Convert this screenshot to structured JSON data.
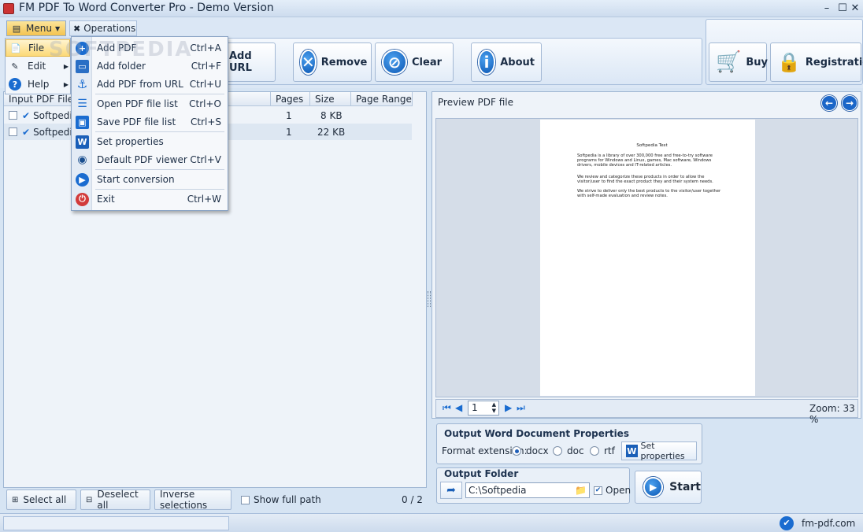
{
  "window": {
    "title": "FM PDF To Word Converter Pro - Demo Version",
    "min": "–",
    "max": "☐",
    "close": "✕"
  },
  "menubar": {
    "menu_label": "Menu",
    "operations_label": "Operations"
  },
  "left_menu": [
    {
      "label": "File",
      "selected": true
    },
    {
      "label": "Edit",
      "selected": false
    },
    {
      "label": "Help",
      "selected": false
    }
  ],
  "dropdown": [
    {
      "label": "Add PDF",
      "shortcut": "Ctrl+A",
      "icon": "plus-icon"
    },
    {
      "label": "Add folder",
      "shortcut": "Ctrl+F",
      "icon": "folder-icon"
    },
    {
      "label": "Add PDF from URL",
      "shortcut": "Ctrl+U",
      "icon": "anchor-icon"
    },
    {
      "label": "Open PDF file list",
      "shortcut": "Ctrl+O",
      "icon": "list-icon"
    },
    {
      "label": "Save PDF file list",
      "shortcut": "Ctrl+S",
      "icon": "floppy-icon"
    },
    {
      "label": "Set properties",
      "shortcut": "",
      "icon": "word-icon"
    },
    {
      "label": "Default PDF viewer",
      "shortcut": "Ctrl+V",
      "icon": "eye-icon"
    },
    {
      "label": "Start conversion",
      "shortcut": "",
      "icon": "play-icon"
    },
    {
      "label": "Exit",
      "shortcut": "Ctrl+W",
      "icon": "power-icon"
    }
  ],
  "toolbar": {
    "add_url": "Add URL",
    "remove": "Remove",
    "clear": "Clear",
    "about": "About",
    "buy": "Buy",
    "registration": "Registration"
  },
  "file_list": {
    "columns": [
      "Input PDF File",
      "Pages",
      "Size",
      "Page Range"
    ],
    "rows": [
      {
        "name": "Softpedia",
        "pages": "1",
        "size": "8 KB",
        "range": ""
      },
      {
        "name": "Softpedia",
        "pages": "1",
        "size": "22 KB",
        "range": ""
      }
    ]
  },
  "list_footer": {
    "select_all": "Select all",
    "deselect_all": "Deselect all",
    "inverse": "Inverse selections",
    "show_full_path": "Show full path",
    "count": "0 / 2"
  },
  "preview": {
    "title": "Preview PDF file",
    "page_value": "1",
    "zoom": "Zoom: 33 %",
    "doc_title": "Softpedia Test",
    "doc_p1": "Softpedia is a library of over 300,000 free and free-to-try software programs for Windows and Linux, games, Mac software, Windows drivers, mobile devices and IT-related articles.",
    "doc_p2": "We review and categorize these products in order to allow the visitor/user to find the exact product they and their system needs.",
    "doc_p3": "We strive to deliver only the best products to the visitor/user together with self-made evaluation and review notes."
  },
  "output_props": {
    "title": "Output Word Document Properties",
    "format_label": "Format extension:",
    "formats": [
      "docx",
      "doc",
      "rtf"
    ],
    "selected": "docx",
    "set_properties": "Set properties"
  },
  "output_folder": {
    "title": "Output Folder",
    "path": "C:\\Softpedia",
    "open_label": "Open",
    "open_checked": true,
    "start": "Start"
  },
  "status": {
    "site": "fm-pdf.com"
  },
  "watermark": "SOFTPEDIA",
  "colors": {
    "accent": "#1a6cd0",
    "menu_highlight": "#fcd977"
  }
}
